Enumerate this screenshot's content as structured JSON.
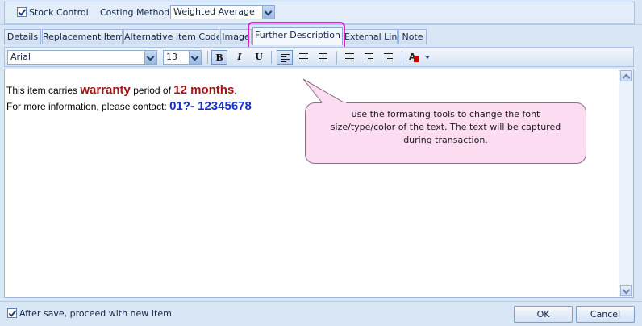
{
  "top": {
    "stock_control_label": "Stock Control",
    "stock_control_checked": true,
    "costing_method_label": "Costing Method:",
    "costing_method_value": "Weighted Average"
  },
  "tabs": [
    {
      "label": "Details"
    },
    {
      "label": "Replacement Item"
    },
    {
      "label": "Alternative Item Code"
    },
    {
      "label": "Image"
    },
    {
      "label": "Further Description",
      "active": true
    },
    {
      "label": "External Link"
    },
    {
      "label": "Note"
    }
  ],
  "toolbar": {
    "font_name": "Arial",
    "font_size": "13",
    "bold_label": "B",
    "italic_label": "I",
    "underline_label": "U",
    "font_color": "#c40000"
  },
  "editor": {
    "line1_prefix": "This item carries ",
    "line1_highlight": "warranty",
    "line1_middle": " period of ",
    "line1_period": "12 months",
    "line1_suffix": ".",
    "line2_prefix": "For more information, please contact: ",
    "line2_phone": "01?- 12345678"
  },
  "callout": {
    "text": "use the formating tools to change the font size/type/color of the text. The text will be captured during transaction."
  },
  "bottom": {
    "proceed_label": "After save, proceed with new Item.",
    "proceed_checked": true,
    "ok_label": "OK",
    "cancel_label": "Cancel"
  },
  "colors": {
    "highlight_border": "#e21fc9",
    "callout_fill": "#fcdcf1",
    "warranty_text": "#a31515",
    "phone_text": "#1530c8"
  }
}
